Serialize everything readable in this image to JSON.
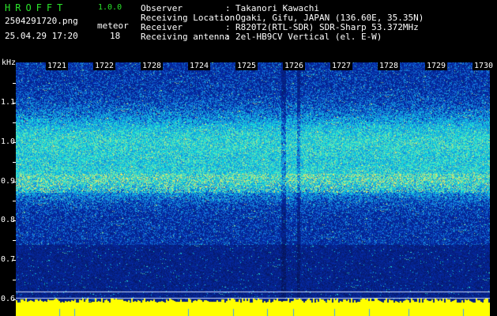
{
  "header": {
    "app_name": "HROFFT",
    "version": "1.0.0",
    "filename": "2504291720.png",
    "datetime": "25.04.29 17:20",
    "meteor_label": "meteor",
    "meteor_count": "18"
  },
  "info": [
    {
      "key": "Observer",
      "value": "Takanori Kawachi"
    },
    {
      "key": "Receiving Location",
      "value": "Ogaki, Gifu, JAPAN (136.60E, 35.35N)"
    },
    {
      "key": "Receiver",
      "value": "R820T2(RTL-SDR) SDR-Sharp 53.372MHz"
    },
    {
      "key": "Receiving antenna",
      "value": "2el-HB9CV Vertical (el. E-W)"
    }
  ],
  "plot": {
    "y_unit": "kHz",
    "y_ticks": [
      "1.1",
      "1.0",
      "0.9",
      "0.8",
      "0.7",
      "0.6"
    ],
    "x_ticks": [
      "1721",
      "1722",
      "1728",
      "1724",
      "1725",
      "1726",
      "1727",
      "1728",
      "1729",
      "1730"
    ]
  },
  "colors": {
    "background": "#000000",
    "spectrogram_base": "#0a1a7a",
    "signal": "#38e0e0",
    "strong_signal": "#f0f040",
    "baseline": "#ffff00",
    "app_name": "#2be52b"
  }
}
